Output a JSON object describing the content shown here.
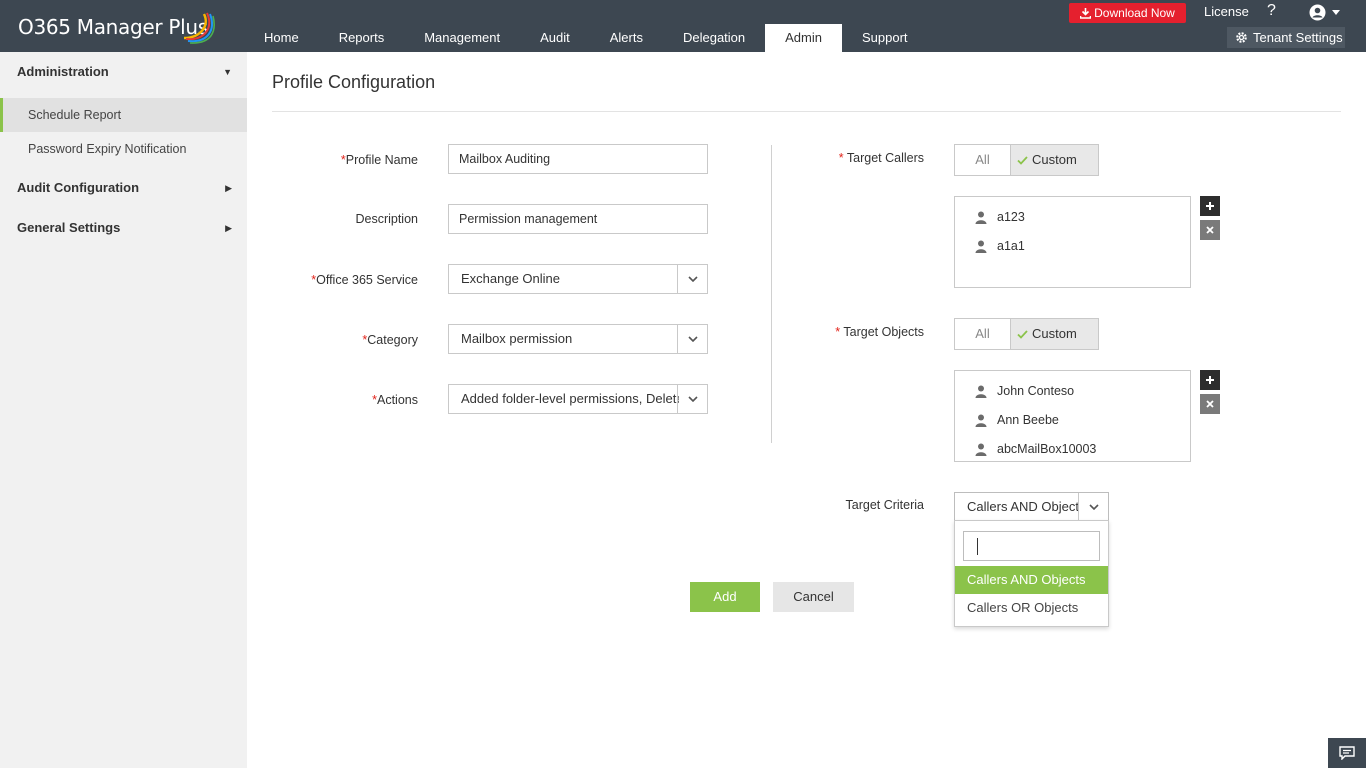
{
  "app": {
    "title": "O365 Manager Plus",
    "brand_color": "#3d4751",
    "accent_color": "#8bc34a"
  },
  "header": {
    "nav": [
      "Home",
      "Reports",
      "Management",
      "Audit",
      "Alerts",
      "Delegation",
      "Admin",
      "Support"
    ],
    "active_nav": "Admin",
    "download_label": "Download Now",
    "license_label": "License",
    "help_label": "?",
    "tenant_settings_label": "Tenant Settings"
  },
  "sidebar": {
    "sections": [
      {
        "label": "Administration",
        "expanded": true
      },
      {
        "label": "Audit Configuration",
        "expanded": false
      },
      {
        "label": "General Settings",
        "expanded": false
      }
    ],
    "items": [
      {
        "label": "Schedule Report",
        "active": true
      },
      {
        "label": "Password Expiry Notification",
        "active": false
      }
    ]
  },
  "page": {
    "title": "Profile Configuration"
  },
  "form": {
    "profile_name": {
      "label": "Profile Name",
      "required_mark": "*",
      "value": "Mailbox Auditing"
    },
    "description": {
      "label": "Description",
      "value": "Permission management"
    },
    "service": {
      "label": "Office 365 Service",
      "required_mark": "*",
      "value": "Exchange Online"
    },
    "category": {
      "label": "Category",
      "required_mark": "*",
      "value": "Mailbox permission"
    },
    "actions": {
      "label": "Actions",
      "required_mark": "*",
      "value": "Added folder-level permissions, Deleted"
    },
    "target_callers": {
      "label": "Target Callers",
      "required_mark": "*",
      "option_all": "All",
      "option_custom": "Custom",
      "selected": "Custom",
      "items": [
        "a123",
        "a1a1"
      ]
    },
    "target_objects": {
      "label": "Target Objects",
      "required_mark": "*",
      "option_all": "All",
      "option_custom": "Custom",
      "selected": "Custom",
      "items": [
        "John Conteso",
        "Ann Beebe",
        "abcMailBox10003"
      ]
    },
    "target_criteria": {
      "label": "Target Criteria",
      "value": "Callers AND Objects",
      "search_value": "",
      "options": [
        "Callers AND Objects",
        "Callers OR Objects"
      ],
      "highlighted": "Callers AND Objects"
    },
    "add_label": "Add",
    "cancel_label": "Cancel"
  }
}
